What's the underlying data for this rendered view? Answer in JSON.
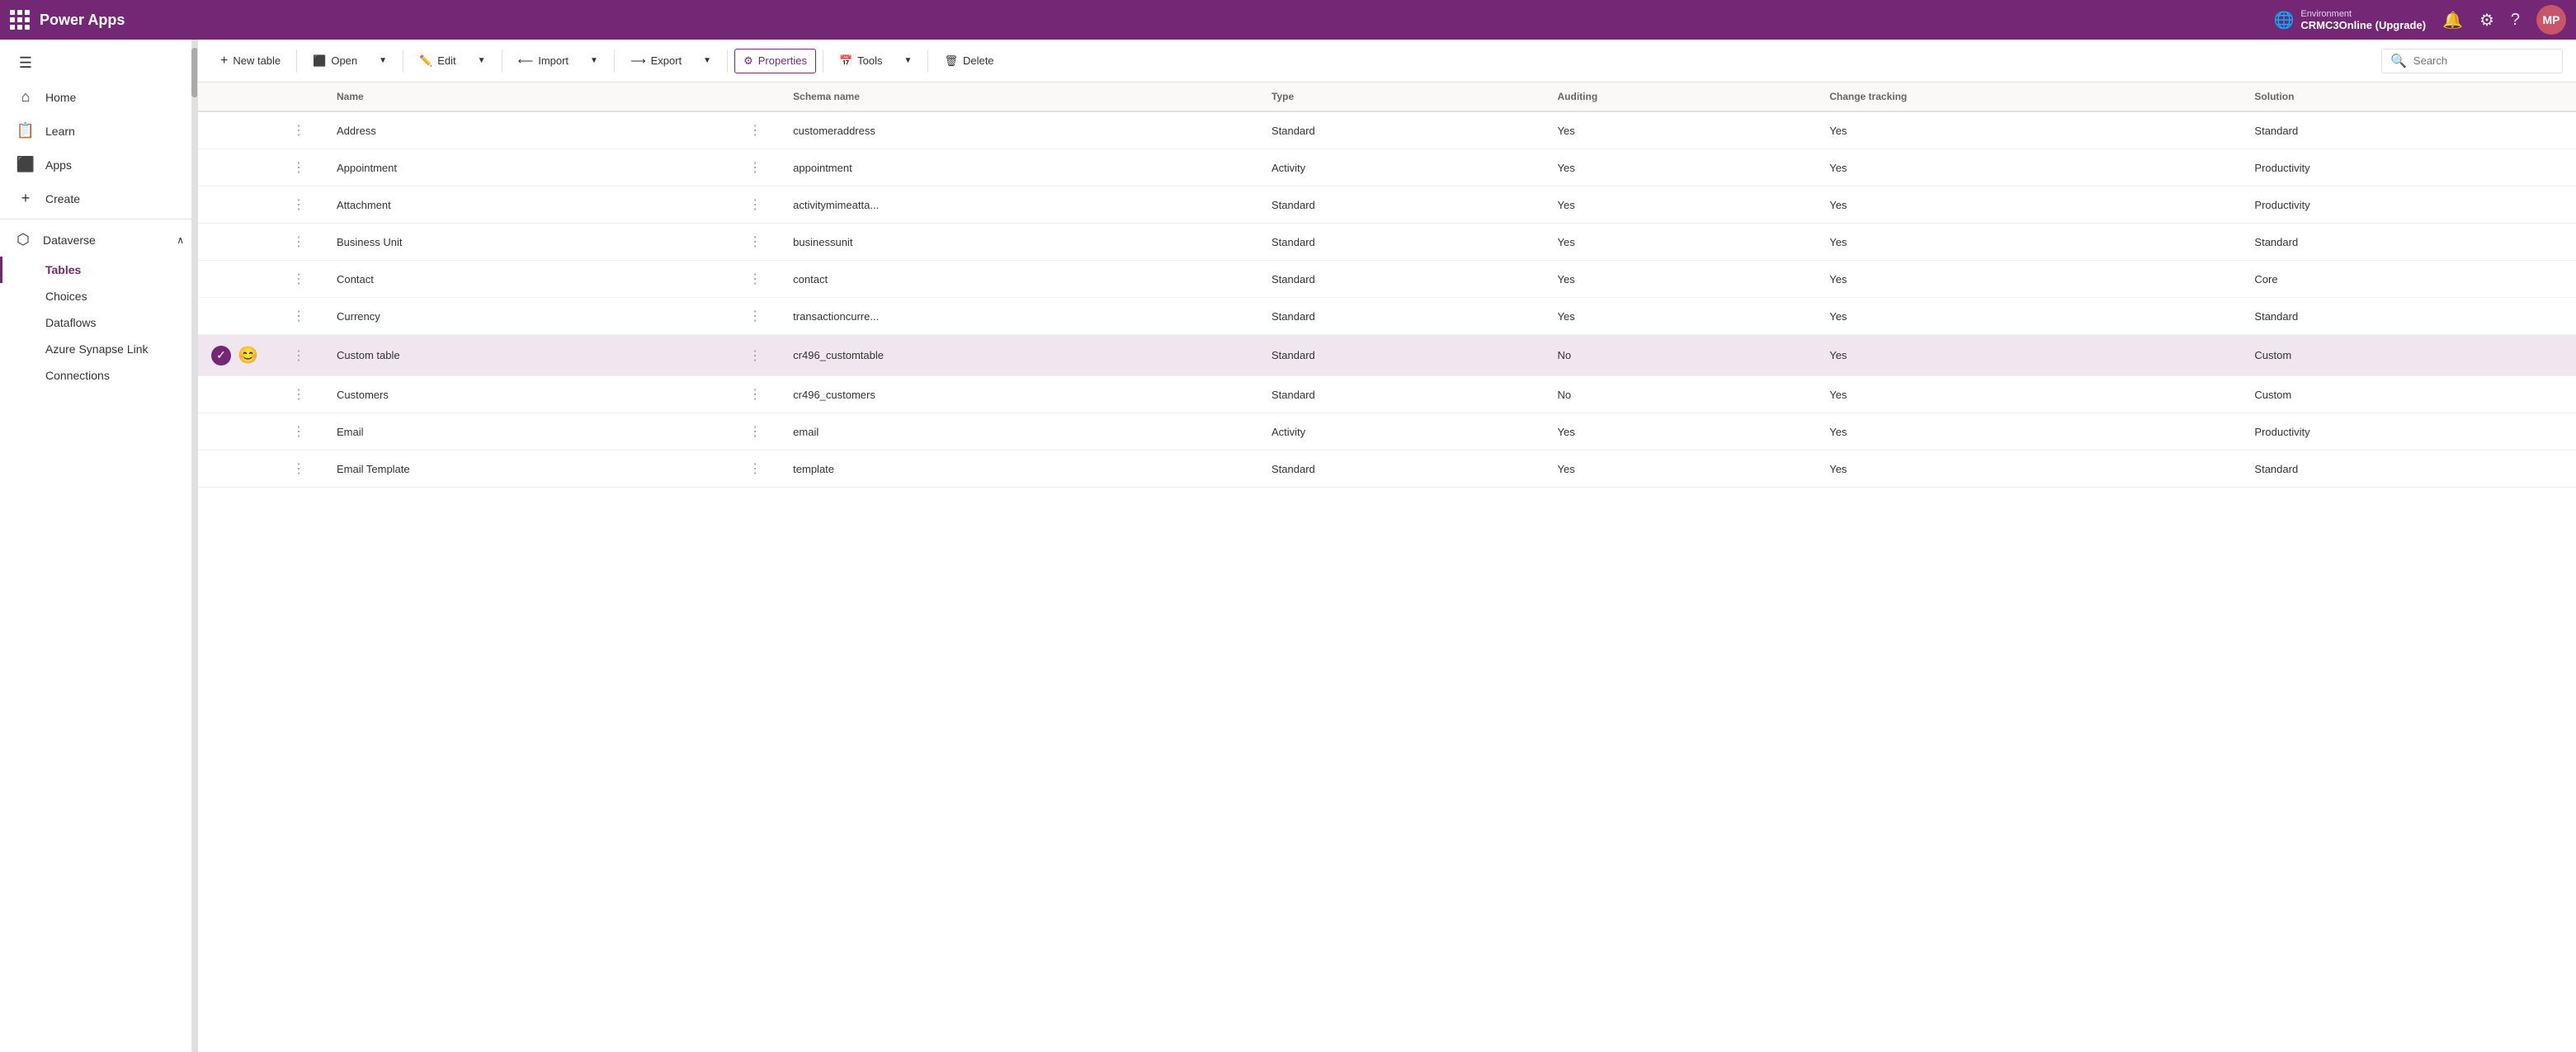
{
  "topbar": {
    "waffle_label": "App launcher",
    "title": "Power Apps",
    "env_label": "Environment",
    "env_name": "CRMC3Online (Upgrade)",
    "notification_icon": "🔔",
    "settings_icon": "⚙",
    "help_icon": "?",
    "avatar_initials": "MP"
  },
  "sidebar": {
    "collapse_icon": "☰",
    "items": [
      {
        "id": "home",
        "icon": "🏠",
        "label": "Home",
        "active": false
      },
      {
        "id": "learn",
        "icon": "📖",
        "label": "Learn",
        "active": false
      },
      {
        "id": "apps",
        "icon": "⬛",
        "label": "Apps",
        "active": false
      },
      {
        "id": "create",
        "icon": "+",
        "label": "Create",
        "active": false
      }
    ],
    "dataverse": {
      "label": "Dataverse",
      "icon": "⬡",
      "chevron": "∧",
      "sub_items": [
        {
          "id": "tables",
          "label": "Tables",
          "active": true
        },
        {
          "id": "choices",
          "label": "Choices",
          "active": false
        },
        {
          "id": "dataflows",
          "label": "Dataflows",
          "active": false
        },
        {
          "id": "azure-synapse",
          "label": "Azure Synapse Link",
          "active": false
        },
        {
          "id": "connections",
          "label": "Connections",
          "active": false
        }
      ]
    }
  },
  "toolbar": {
    "new_table_label": "New table",
    "open_label": "Open",
    "edit_label": "Edit",
    "import_label": "Import",
    "export_label": "Export",
    "properties_label": "Properties",
    "tools_label": "Tools",
    "delete_label": "Delete",
    "search_placeholder": "Search"
  },
  "table": {
    "columns": [
      "",
      "",
      "Name",
      "",
      "Schema name",
      "Type",
      "Auditing",
      "Change tracking",
      "Solution"
    ],
    "rows": [
      {
        "id": "address",
        "name": "Address",
        "schema_name": "customeraddress",
        "type": "Standard",
        "auditing": "Yes",
        "change_tracking": "Yes",
        "solution": "Standard",
        "selected": false,
        "has_check": false,
        "has_emoji": false
      },
      {
        "id": "appointment",
        "name": "Appointment",
        "schema_name": "appointment",
        "type": "Activity",
        "auditing": "Yes",
        "change_tracking": "Yes",
        "solution": "Productivity",
        "selected": false,
        "has_check": false,
        "has_emoji": false
      },
      {
        "id": "attachment",
        "name": "Attachment",
        "schema_name": "activitymimeatta...",
        "type": "Standard",
        "auditing": "Yes",
        "change_tracking": "Yes",
        "solution": "Productivity",
        "selected": false,
        "has_check": false,
        "has_emoji": false
      },
      {
        "id": "business-unit",
        "name": "Business Unit",
        "schema_name": "businessunit",
        "type": "Standard",
        "auditing": "Yes",
        "change_tracking": "Yes",
        "solution": "Standard",
        "selected": false,
        "has_check": false,
        "has_emoji": false
      },
      {
        "id": "contact",
        "name": "Contact",
        "schema_name": "contact",
        "type": "Standard",
        "auditing": "Yes",
        "change_tracking": "Yes",
        "solution": "Core",
        "selected": false,
        "has_check": false,
        "has_emoji": false
      },
      {
        "id": "currency",
        "name": "Currency",
        "schema_name": "transactioncurre...",
        "type": "Standard",
        "auditing": "Yes",
        "change_tracking": "Yes",
        "solution": "Standard",
        "selected": false,
        "has_check": false,
        "has_emoji": false
      },
      {
        "id": "custom-table",
        "name": "Custom table",
        "schema_name": "cr496_customtable",
        "type": "Standard",
        "auditing": "No",
        "change_tracking": "Yes",
        "solution": "Custom",
        "selected": true,
        "has_check": true,
        "has_emoji": true,
        "emoji": "😊"
      },
      {
        "id": "customers",
        "name": "Customers",
        "schema_name": "cr496_customers",
        "type": "Standard",
        "auditing": "No",
        "change_tracking": "Yes",
        "solution": "Custom",
        "selected": false,
        "has_check": false,
        "has_emoji": false
      },
      {
        "id": "email",
        "name": "Email",
        "schema_name": "email",
        "type": "Activity",
        "auditing": "Yes",
        "change_tracking": "Yes",
        "solution": "Productivity",
        "selected": false,
        "has_check": false,
        "has_emoji": false
      },
      {
        "id": "email-template",
        "name": "Email Template",
        "schema_name": "template",
        "type": "Standard",
        "auditing": "Yes",
        "change_tracking": "Yes",
        "solution": "Standard",
        "selected": false,
        "has_check": false,
        "has_emoji": false
      }
    ]
  }
}
